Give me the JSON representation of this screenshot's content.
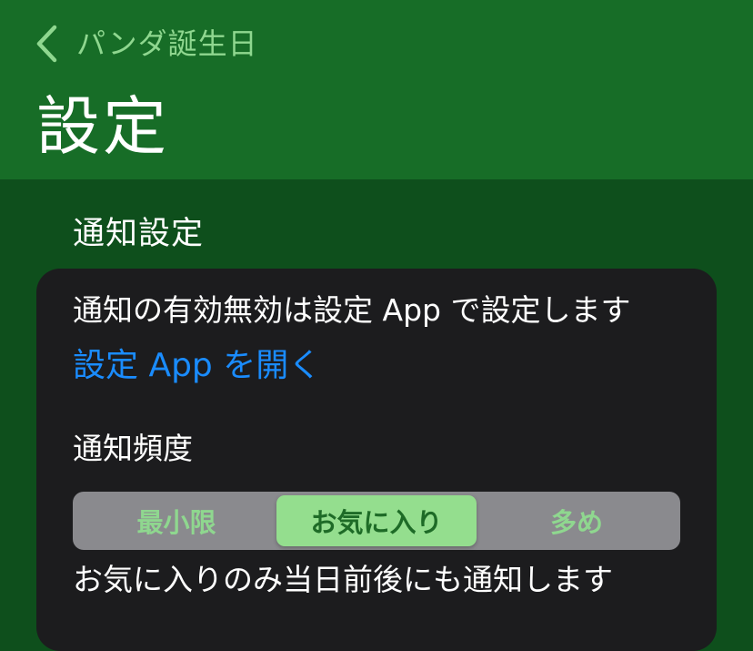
{
  "colors": {
    "nav_bar": "#176d27",
    "background": "#0e4f1c",
    "accent_green": "#8fd78f",
    "card": "#1c1c1e",
    "link_blue": "#1a8cff",
    "segment_track": "#8a8a8e",
    "segment_selected": "#94de8e"
  },
  "nav": {
    "back_icon": "chevron-left-icon",
    "back_label": "パンダ誕生日",
    "title": "設定"
  },
  "notification_section": {
    "header": "通知設定",
    "info_text": "通知の有効無効は設定 App で設定します",
    "open_settings_link": "設定 App を開く",
    "frequency_label": "通知頻度",
    "frequency_options": [
      {
        "label": "最小限",
        "selected": false
      },
      {
        "label": "お気に入り",
        "selected": true
      },
      {
        "label": "多め",
        "selected": false
      }
    ],
    "frequency_description": "お気に入りのみ当日前後にも通知します"
  }
}
